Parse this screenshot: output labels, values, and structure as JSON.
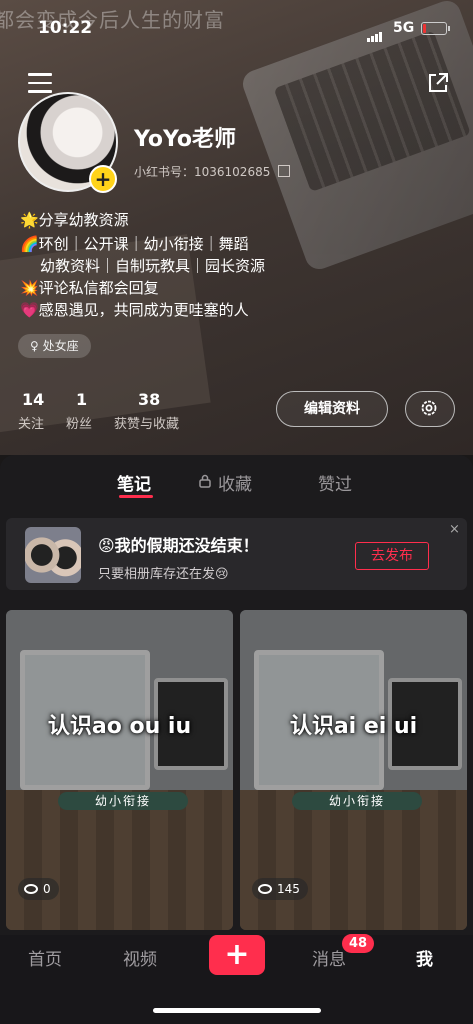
{
  "status_bar": {
    "time": "10:22",
    "network": "5G"
  },
  "background_caption": "都会变成今后人生的财富",
  "profile": {
    "name": "YoYo老师",
    "redbook_id": "小红书号：1036102685",
    "bio_lines": [
      "🌟分享幼教资源",
      "🌈环创｜公开课｜幼小衔接｜舞蹈",
      "幼教资料｜自制玩教具｜园长资源",
      "💥评论私信都会回复",
      "💗感恩遇见，共同成为更哇塞的人"
    ],
    "tag": "♀ 处女座",
    "stats": [
      {
        "value": "14",
        "label": "关注"
      },
      {
        "value": "1",
        "label": "粉丝"
      },
      {
        "value": "38",
        "label": "获赞与收藏"
      }
    ],
    "edit_label": "编辑资料"
  },
  "tabs": {
    "notes": "笔记",
    "favorites": "收藏",
    "liked": "赞过"
  },
  "promo": {
    "title": "😡我的假期还没结束！",
    "subtitle": "只要相册库存还在发😢",
    "button": "去发布",
    "close": "×"
  },
  "notes": [
    {
      "title": "认识ao ou iu",
      "tag": "幼小衔接",
      "views": "0"
    },
    {
      "title": "认识ai ei ui",
      "tag": "幼小衔接",
      "views": "145"
    }
  ],
  "bottom_nav": {
    "home": "首页",
    "video": "视频",
    "add": "+",
    "messages": "消息",
    "messages_badge": "48",
    "me": "我"
  },
  "colors": {
    "accent": "#ff2e4d",
    "plus_badge": "#ffd31a"
  }
}
